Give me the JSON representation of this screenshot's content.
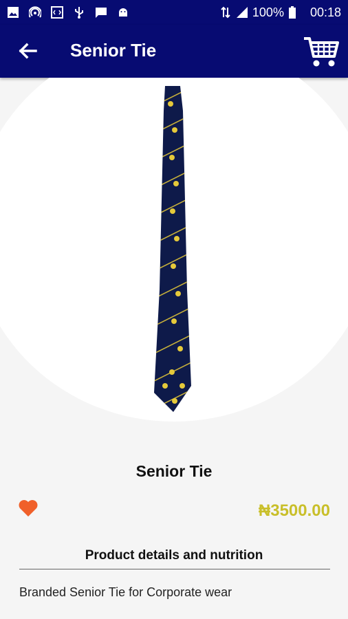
{
  "status_bar": {
    "battery_text": "100%",
    "time": "00:18",
    "icons": [
      "image-icon",
      "hotspot-icon",
      "code-icon",
      "usb-icon",
      "message-icon",
      "android-icon",
      "data-arrows-icon",
      "signal-icon",
      "battery-icon"
    ]
  },
  "app_bar": {
    "title": "Senior Tie",
    "back_icon": "arrow-back-icon",
    "cart_icon": "shopping-cart-icon",
    "background": "#070b72"
  },
  "product": {
    "name": "Senior Tie",
    "price": "₦3500.00",
    "price_color": "#c9bf2a",
    "favorite_icon": "heart-icon",
    "favorite_color": "#f0602a",
    "details_heading": "Product details and nutrition",
    "description": "Branded Senior Tie for Corporate wear"
  }
}
